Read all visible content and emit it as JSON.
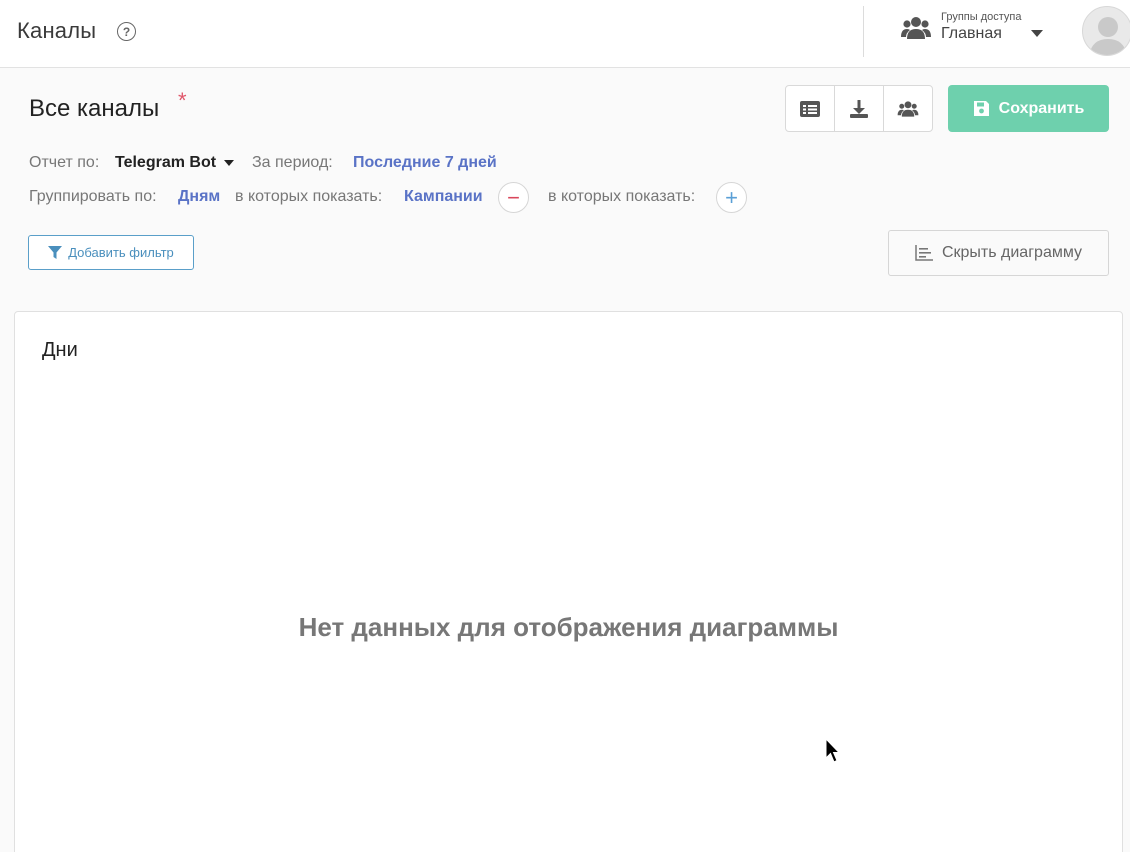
{
  "header": {
    "title": "Каналы",
    "help_symbol": "?",
    "access_caption": "Группы доступа",
    "access_value": "Главная"
  },
  "page": {
    "title": "Все каналы",
    "unsaved_marker": "*",
    "save_label": "Сохранить",
    "icon_buttons": [
      "list-icon",
      "download-icon",
      "users-icon"
    ]
  },
  "report": {
    "report_by_label": "Отчет по:",
    "report_by_value": "Telegram Bot",
    "period_label": "За период:",
    "period_value": "Последние 7 дней",
    "group_by_label": "Группировать по:",
    "group_by_value": "Дням",
    "show_label_1": "в которых показать:",
    "show_value_1": "Кампании",
    "show_label_2": "в которых показать:",
    "minus_symbol": "−",
    "plus_symbol": "+"
  },
  "filters": {
    "add_filter_label": "Добавить фильтр",
    "hide_chart_label": "Скрыть диаграмму"
  },
  "chart_panel": {
    "title": "Дни",
    "empty_message": "Нет данных для отображения диаграммы"
  },
  "colors": {
    "accent_save": "#6ed0ad",
    "link": "#5a73c6",
    "danger": "#d9465b",
    "info": "#5a9fd6"
  }
}
